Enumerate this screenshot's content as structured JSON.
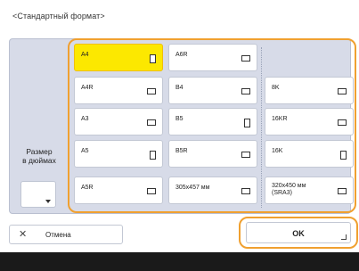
{
  "title": "<Стандартный формат>",
  "side": {
    "label_line1": "Размер",
    "label_line2": "в дюймах"
  },
  "columns": [
    [
      {
        "label": "A4",
        "icon": "portrait",
        "selected": true
      },
      {
        "label": "A4R",
        "icon": "landscape",
        "selected": false
      },
      {
        "label": "A3",
        "icon": "landscape",
        "selected": false
      },
      {
        "label": "A5",
        "icon": "portrait",
        "selected": false
      },
      {
        "label": "A5R",
        "icon": "landscape",
        "selected": false
      }
    ],
    [
      {
        "label": "A6R",
        "icon": "landscape",
        "selected": false
      },
      {
        "label": "B4",
        "icon": "landscape",
        "selected": false
      },
      {
        "label": "B5",
        "icon": "portrait",
        "selected": false
      },
      {
        "label": "B5R",
        "icon": "landscape",
        "selected": false
      },
      {
        "label": "305x457 мм",
        "icon": "landscape",
        "selected": false
      }
    ],
    [
      {
        "label": "",
        "icon": "",
        "selected": false
      },
      {
        "label": "8K",
        "icon": "landscape",
        "selected": false
      },
      {
        "label": "16KR",
        "icon": "landscape",
        "selected": false
      },
      {
        "label": "16K",
        "icon": "portrait",
        "selected": false
      },
      {
        "label": "320x450 мм (SRA3)",
        "icon": "landscape",
        "selected": false
      }
    ]
  ],
  "cancel_label": "Отмена",
  "cancel_icon": "close-icon",
  "ok_label": "OK",
  "accent_color": "#f0a030",
  "selected_color": "#fce800"
}
